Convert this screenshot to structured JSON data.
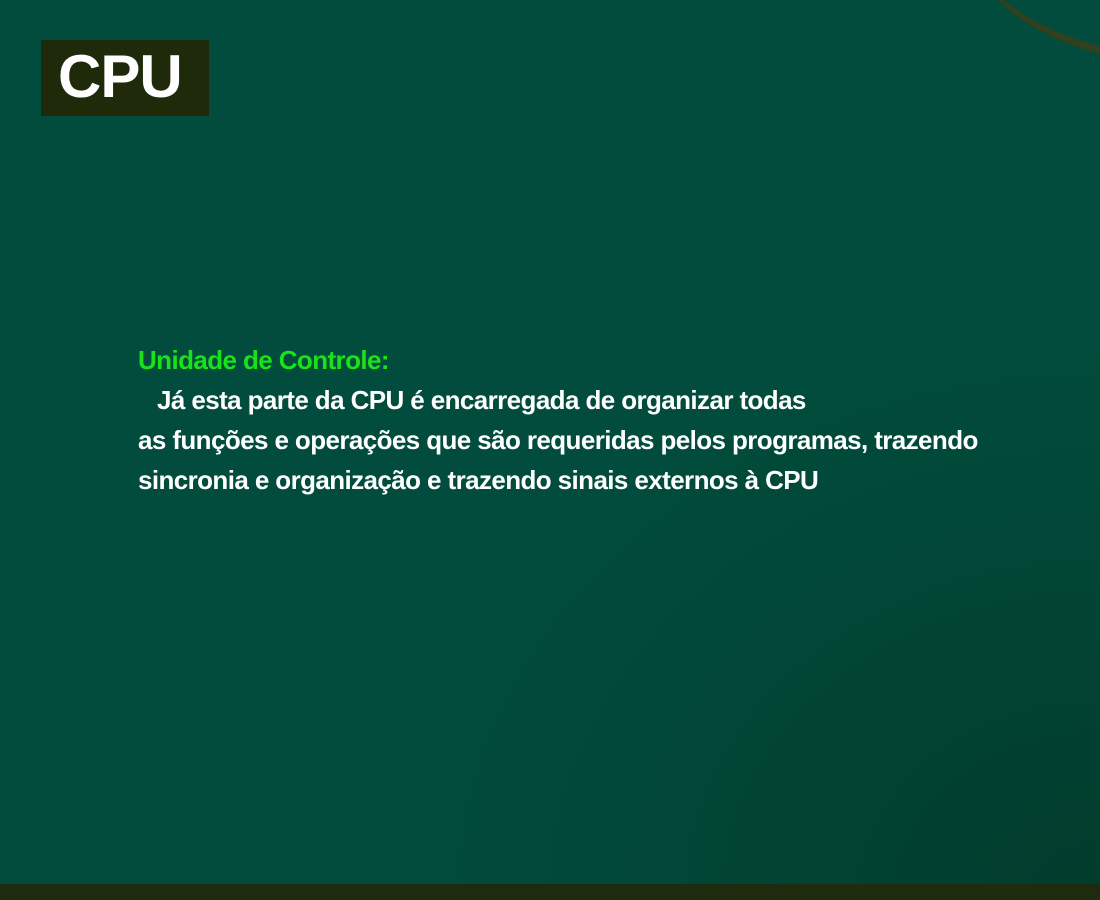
{
  "slide": {
    "title": "CPU",
    "heading": "Unidade de Controle:",
    "body_lines": [
      "Já esta parte da CPU é encarregada de organizar todas",
      "as funções e operações que são requeridas pelos programas, trazendo",
      "sincronia e organização e trazendo sinais externos à CPU"
    ]
  },
  "colors": {
    "background": "#014c3c",
    "title_box": "#1f2a0b",
    "heading_text": "#19e21b",
    "body_text": "#ffffff",
    "bottom_bar": "#1f2b0f"
  }
}
